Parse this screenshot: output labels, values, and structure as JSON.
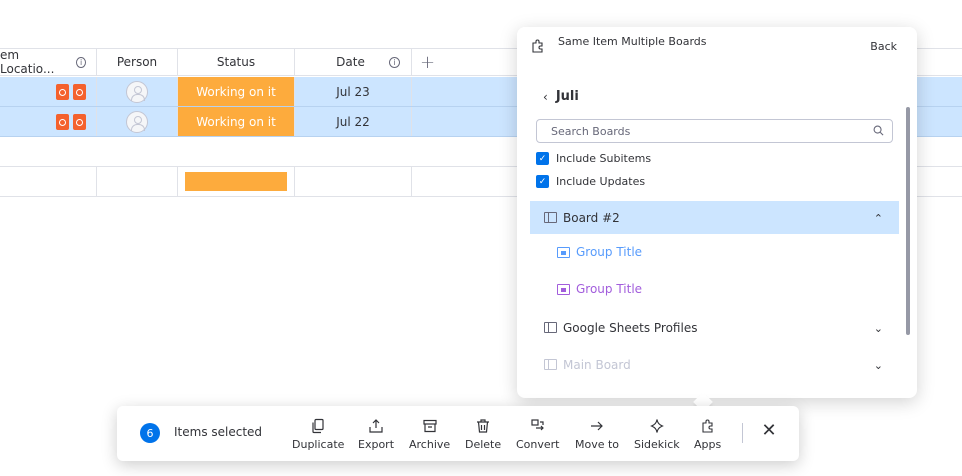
{
  "table": {
    "headers": {
      "location": "em Locatio...",
      "person": "Person",
      "status": "Status",
      "date": "Date",
      "add": "+"
    },
    "rows": [
      {
        "status": "Working on it",
        "date": "Jul 23"
      },
      {
        "status": "Working on it",
        "date": "Jul 22"
      }
    ],
    "colors": {
      "status_working": "#fdab3d",
      "selected_row": "#cce5ff"
    }
  },
  "panel": {
    "title": "Same Item Multiple Boards",
    "back_label": "Back",
    "workspace": "Juli",
    "search_placeholder": "Search Boards",
    "include_subitems": "Include Subitems",
    "include_updates": "Include Updates",
    "boards": [
      {
        "name": "Board #2",
        "expanded": true,
        "groups": [
          {
            "name": "Group Title",
            "color": "#579bfc"
          },
          {
            "name": "Group Title",
            "color": "#a25ddc"
          }
        ]
      },
      {
        "name": "Google Sheets Profiles",
        "expanded": false
      },
      {
        "name": "Main Board",
        "expanded": false,
        "disabled": true
      }
    ]
  },
  "toolbar": {
    "count": "6",
    "selected_label": "Items selected",
    "actions": {
      "duplicate": "Duplicate",
      "export": "Export",
      "archive": "Archive",
      "delete": "Delete",
      "convert": "Convert",
      "move_to": "Move to",
      "sidekick": "Sidekick",
      "apps": "Apps"
    },
    "accent": "#0073ea"
  }
}
